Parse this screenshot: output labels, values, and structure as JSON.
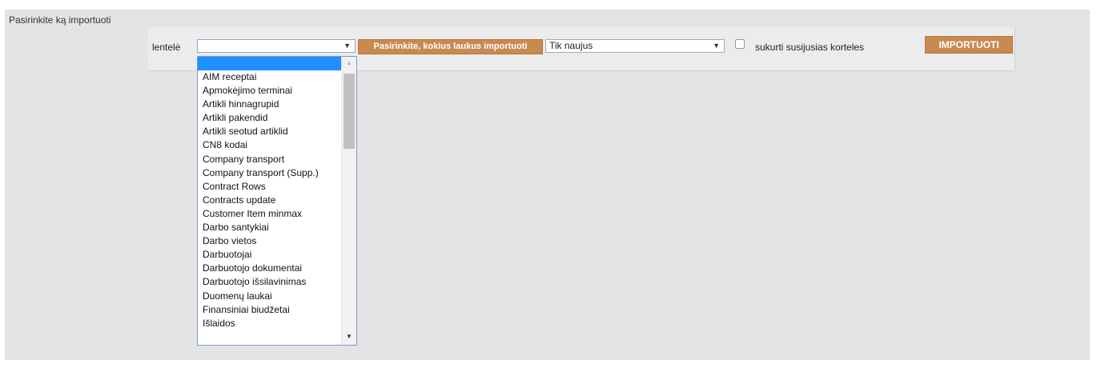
{
  "panel": {
    "title": "Pasirinkite ką importuoti"
  },
  "toolbar": {
    "table_label": "lentelė",
    "table_select": {
      "value": "",
      "arrow": "▼"
    },
    "fields_button": "Pasirinkite,  kokius laukus importuoti",
    "mode_select": {
      "value": "Tik naujus",
      "arrow": "▼"
    },
    "create_related_label": "sukurti susijusias korteles",
    "import_button": "IMPORTUOTI"
  },
  "dropdown": {
    "scroll_up": "▲",
    "scroll_down": "▼",
    "items": [
      "AIM receptai",
      "Apmokėjimo terminai",
      "Artikli hinnagrupid",
      "Artikli pakendid",
      "Artikli seotud artiklid",
      "CN8 kodai",
      "Company transport",
      "Company transport (Supp.)",
      "Contract Rows",
      "Contracts update",
      "Customer Item minmax",
      "Darbo santykiai",
      "Darbo vietos",
      "Darbuotojai",
      "Darbuotojo dokumentai",
      "Darbuotojo išsilavinimas",
      "Duomenų laukai",
      "Finansiniai biudžetai",
      "Išlaidos"
    ]
  }
}
